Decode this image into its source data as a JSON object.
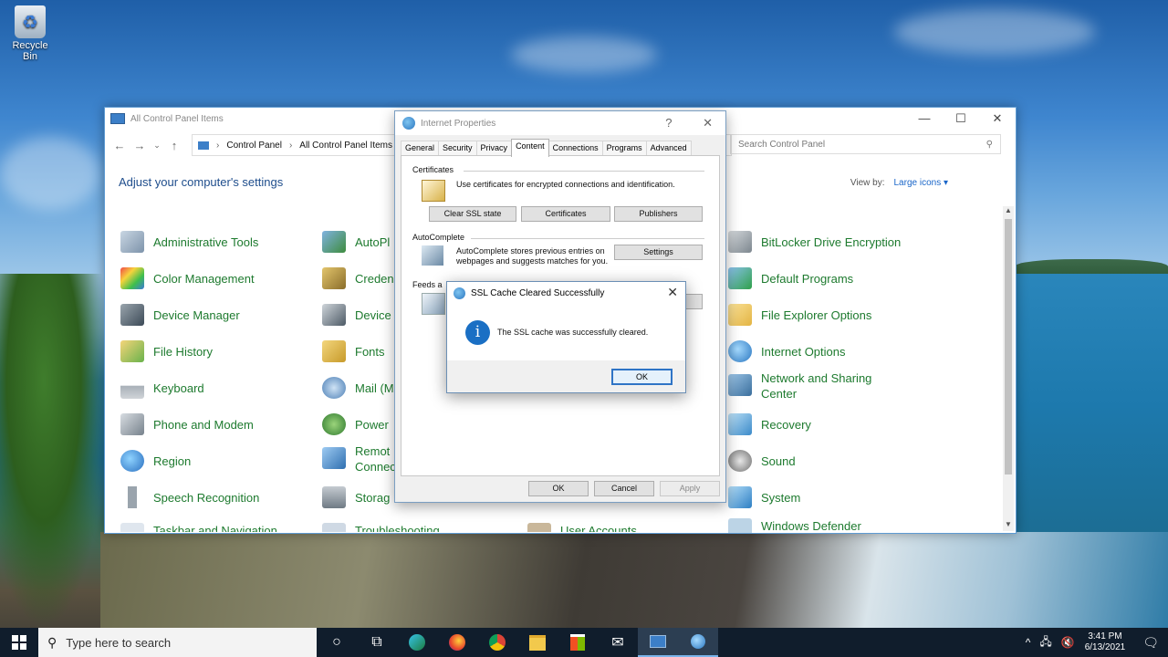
{
  "desktop": {
    "recycle_bin": "Recycle Bin"
  },
  "control_panel": {
    "title": "All Control Panel Items",
    "window_controls": [
      "—",
      "☐",
      "✕"
    ],
    "nav": [
      "←",
      "→",
      "⌄",
      "↑"
    ],
    "breadcrumb": [
      "Control Panel",
      "All Control Panel Items"
    ],
    "search_placeholder": "Search Control Panel",
    "heading": "Adjust your computer's settings",
    "view_by_label": "View by:",
    "view_by_value": "Large icons ▾",
    "col1": [
      "Administrative Tools",
      "Color Management",
      "Device Manager",
      "File History",
      "Keyboard",
      "Phone and Modem",
      "Region",
      "Speech Recognition",
      "Taskbar and Navigation"
    ],
    "col2": [
      "AutoPl",
      "Creden",
      "Device",
      "Fonts",
      "Mail (M",
      "Power",
      "Remot",
      "Connec",
      "Storag",
      "Troubleshooting"
    ],
    "col3": [
      "User Accounts"
    ],
    "col4": [
      "BitLocker Drive Encryption",
      "Default Programs",
      "File Explorer Options",
      "Internet Options",
      "Network and Sharing",
      "Center",
      "Recovery",
      "Sound",
      "System",
      "Windows Defender"
    ],
    "colors": {
      "link_green": "#1d7a2e",
      "heading_blue": "#1e4d8c"
    },
    "icons": [
      "admin-tools-icon",
      "color-mgmt-icon",
      "device-manager-icon",
      "file-history-icon",
      "keyboard-icon",
      "phone-modem-icon",
      "region-icon",
      "speech-icon",
      "taskbar-icon",
      "bitlocker-icon",
      "default-programs-icon",
      "file-explorer-icon",
      "internet-options-icon",
      "network-icon",
      "recovery-icon",
      "sound-icon",
      "system-icon",
      "windows-defender-icon"
    ]
  },
  "internet_properties": {
    "title": "Internet Properties",
    "help": "?",
    "close": "✕",
    "tabs": [
      "General",
      "Security",
      "Privacy",
      "Content",
      "Connections",
      "Programs",
      "Advanced"
    ],
    "active_tab": "Content",
    "certificates_label": "Certificates",
    "certificates_desc": "Use certificates for encrypted connections and identification.",
    "clear_ssl": "Clear SSL state",
    "certificates_btn": "Certificates",
    "publishers_btn": "Publishers",
    "autocomplete_label": "AutoComplete",
    "autocomplete_desc": "AutoComplete stores previous entries on webpages and suggests matches for you.",
    "settings_btn": "Settings",
    "feeds_label": "Feeds a",
    "ok": "OK",
    "cancel": "Cancel",
    "apply": "Apply"
  },
  "message_box": {
    "title": "SSL Cache Cleared Successfully",
    "close": "✕",
    "icon_glyph": "i",
    "message": "The SSL cache was successfully cleared.",
    "ok": "OK"
  },
  "taskbar": {
    "search_text": "Type here to search",
    "time": "3:41 PM",
    "date": "6/13/2021",
    "tray_icons": [
      "^",
      "🖧",
      "🔇"
    ]
  }
}
